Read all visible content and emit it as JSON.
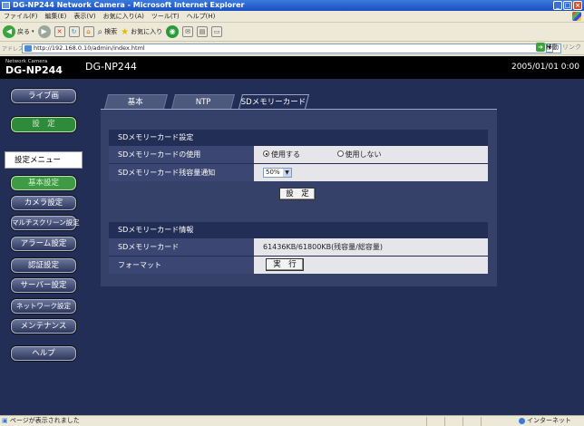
{
  "window": {
    "title": "DG-NP244 Network Camera - Microsoft Internet Explorer",
    "buttons": [
      "_",
      "□",
      "×"
    ]
  },
  "menubar": [
    "ファイル(F)",
    "編集(E)",
    "表示(V)",
    "お気に入り(A)",
    "ツール(T)",
    "ヘルプ(H)"
  ],
  "toolbar": {
    "back": "戻る",
    "search": "検索",
    "favorites": "お気に入り"
  },
  "address": {
    "label": "アドレス(D)",
    "url": "http://192.168.0.10/admin/index.html",
    "go": "移動",
    "links": "リンク"
  },
  "header": {
    "brand": "Network Camera",
    "brand_model": "DG-NP244",
    "model": "DG-NP244",
    "datetime": "2005/01/01  0:00"
  },
  "sidebar": {
    "live": "ライブ画",
    "setup": "設　定",
    "menu_label": "設定メニュー",
    "items": [
      "基本設定",
      "カメラ設定",
      "マルチスクリーン設定",
      "アラーム設定",
      "認証設定",
      "サーバー設定",
      "ネットワーク設定",
      "メンテナンス"
    ],
    "help": "ヘルプ"
  },
  "tabs": [
    "基本",
    "NTP",
    "SDメモリーカード"
  ],
  "sd_settings": {
    "heading": "SDメモリーカード設定",
    "use_label": "SDメモリーカードの使用",
    "use_on": "使用する",
    "use_off": "使用しない",
    "notify_label": "SDメモリーカード残容量通知",
    "notify_value": "50%",
    "set_button": "設　定"
  },
  "sd_info": {
    "heading": "SDメモリーカード情報",
    "card_label": "SDメモリーカード",
    "card_value": "61436KB/61800KB(残容量/総容量)",
    "format_label": "フォーマット",
    "exec_button": "実　行"
  },
  "status": {
    "message": "ページが表示されました",
    "zone": "インターネット"
  }
}
